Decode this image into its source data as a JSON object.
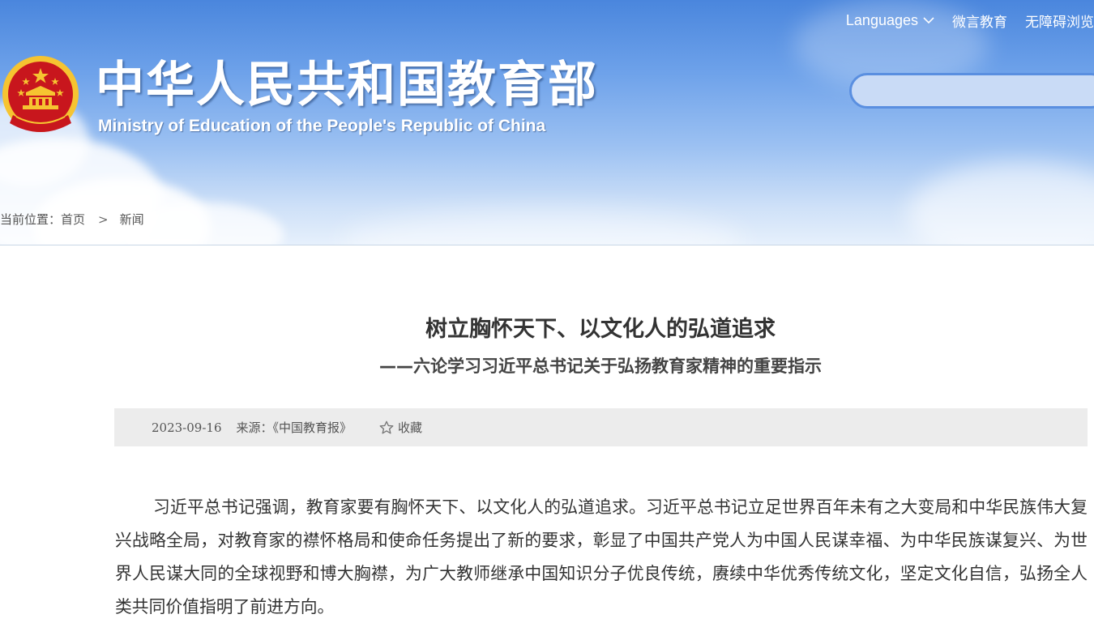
{
  "header": {
    "title": "中华人民共和国教育部",
    "subtitle": "Ministry of Education of the People's Republic of China",
    "emblem_icon": "national-emblem-icon",
    "nav": {
      "languages": "Languages",
      "weiyan": "微言教育",
      "accessibility": "无障碍浏览"
    },
    "search": {
      "value": "",
      "placeholder": ""
    }
  },
  "breadcrumb": {
    "label": "当前位置：",
    "home": "首页",
    "separator": ">",
    "current": "新闻"
  },
  "article": {
    "title": "树立胸怀天下、以文化人的弘道追求",
    "subtitle": "——六论学习习近平总书记关于弘扬教育家精神的重要指示",
    "meta": {
      "date": "2023-09-16",
      "source": "来源：《中国教育报》",
      "favorite": "收藏",
      "favorite_icon": "star-outline-icon"
    },
    "body": "习近平总书记强调，教育家要有胸怀天下、以文化人的弘道追求。习近平总书记立足世界百年未有之大变局和中华民族伟大复兴战略全局，对教育家的襟怀格局和使命任务提出了新的要求，彰显了中国共产党人为中国人民谋幸福、为中华民族谋复兴、为世界人民谋大同的全球视野和博大胸襟，为广大教师继承中国知识分子优良传统，赓续中华优秀传统文化，坚定文化自信，弘扬全人类共同价值指明了前进方向。"
  },
  "colors": {
    "banner_top": "#4a86dd",
    "banner_bottom": "#e6f0fc",
    "emblem_red": "#c8161d",
    "emblem_gold": "#f6c431",
    "meta_bar_bg": "#ececec",
    "text": "#333333"
  }
}
